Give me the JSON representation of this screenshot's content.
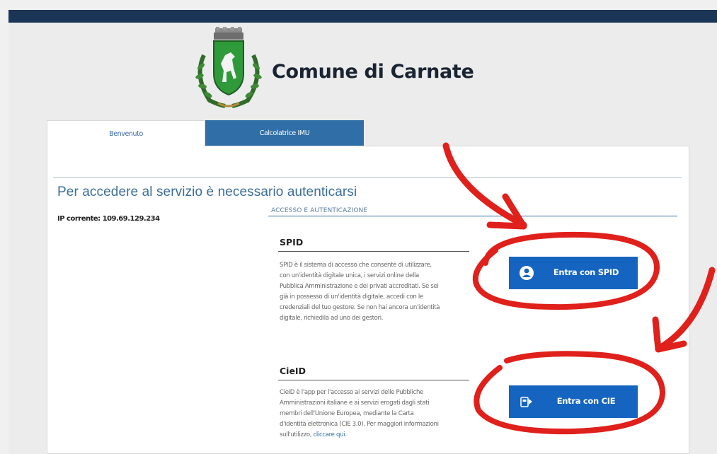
{
  "site": {
    "title": "Comune di Carnate"
  },
  "tabs": [
    {
      "label": "Benvenuto",
      "active": true
    },
    {
      "label": "Calcolatrice IMU",
      "active": false
    }
  ],
  "main": {
    "heading": "Per accedere al servizio è necessario autenticarsi",
    "ip_text": "IP corrente: 109.69.129.234",
    "section_label": "ACCESSO E AUTENTICAZIONE"
  },
  "spid": {
    "title": "SPID",
    "lines": [
      "SPID è il sistema di accesso che consente di utilizzare,",
      "con un'identità digitale unica, i servizi online della",
      "Pubblica Amministrazione e dei privati accreditati. Se sei",
      "già in possesso di un'identità digitale, accedi con le",
      "credenziali del tuo gestore. Se non hai ancora un'identità",
      "digitale, richiedila ad uno dei gestori."
    ],
    "button_label": "Entra con SPID",
    "button_icon": "user-icon"
  },
  "cie": {
    "title": "CieID",
    "lines": [
      "CieID è l'app per l'accesso ai servizi delle Pubbliche",
      "Amministrazioni italiane e ai servizi erogati dagli stati",
      "membri dell'Unione Europea, mediante la Carta",
      "d'identità elettronica (CIE 3.0). Per maggiori informazioni"
    ],
    "last_line_prefix": "sull'utilizzo, ",
    "link_text": "cliccare qui",
    "last_line_suffix": ".",
    "button_label": "Entra con CIE",
    "button_icon": "cie-card-icon"
  },
  "colors": {
    "topbar": "#1a3556",
    "button": "#1565c0",
    "tab_inactive": "#2f6ea6",
    "annotation": "#e0201b"
  }
}
